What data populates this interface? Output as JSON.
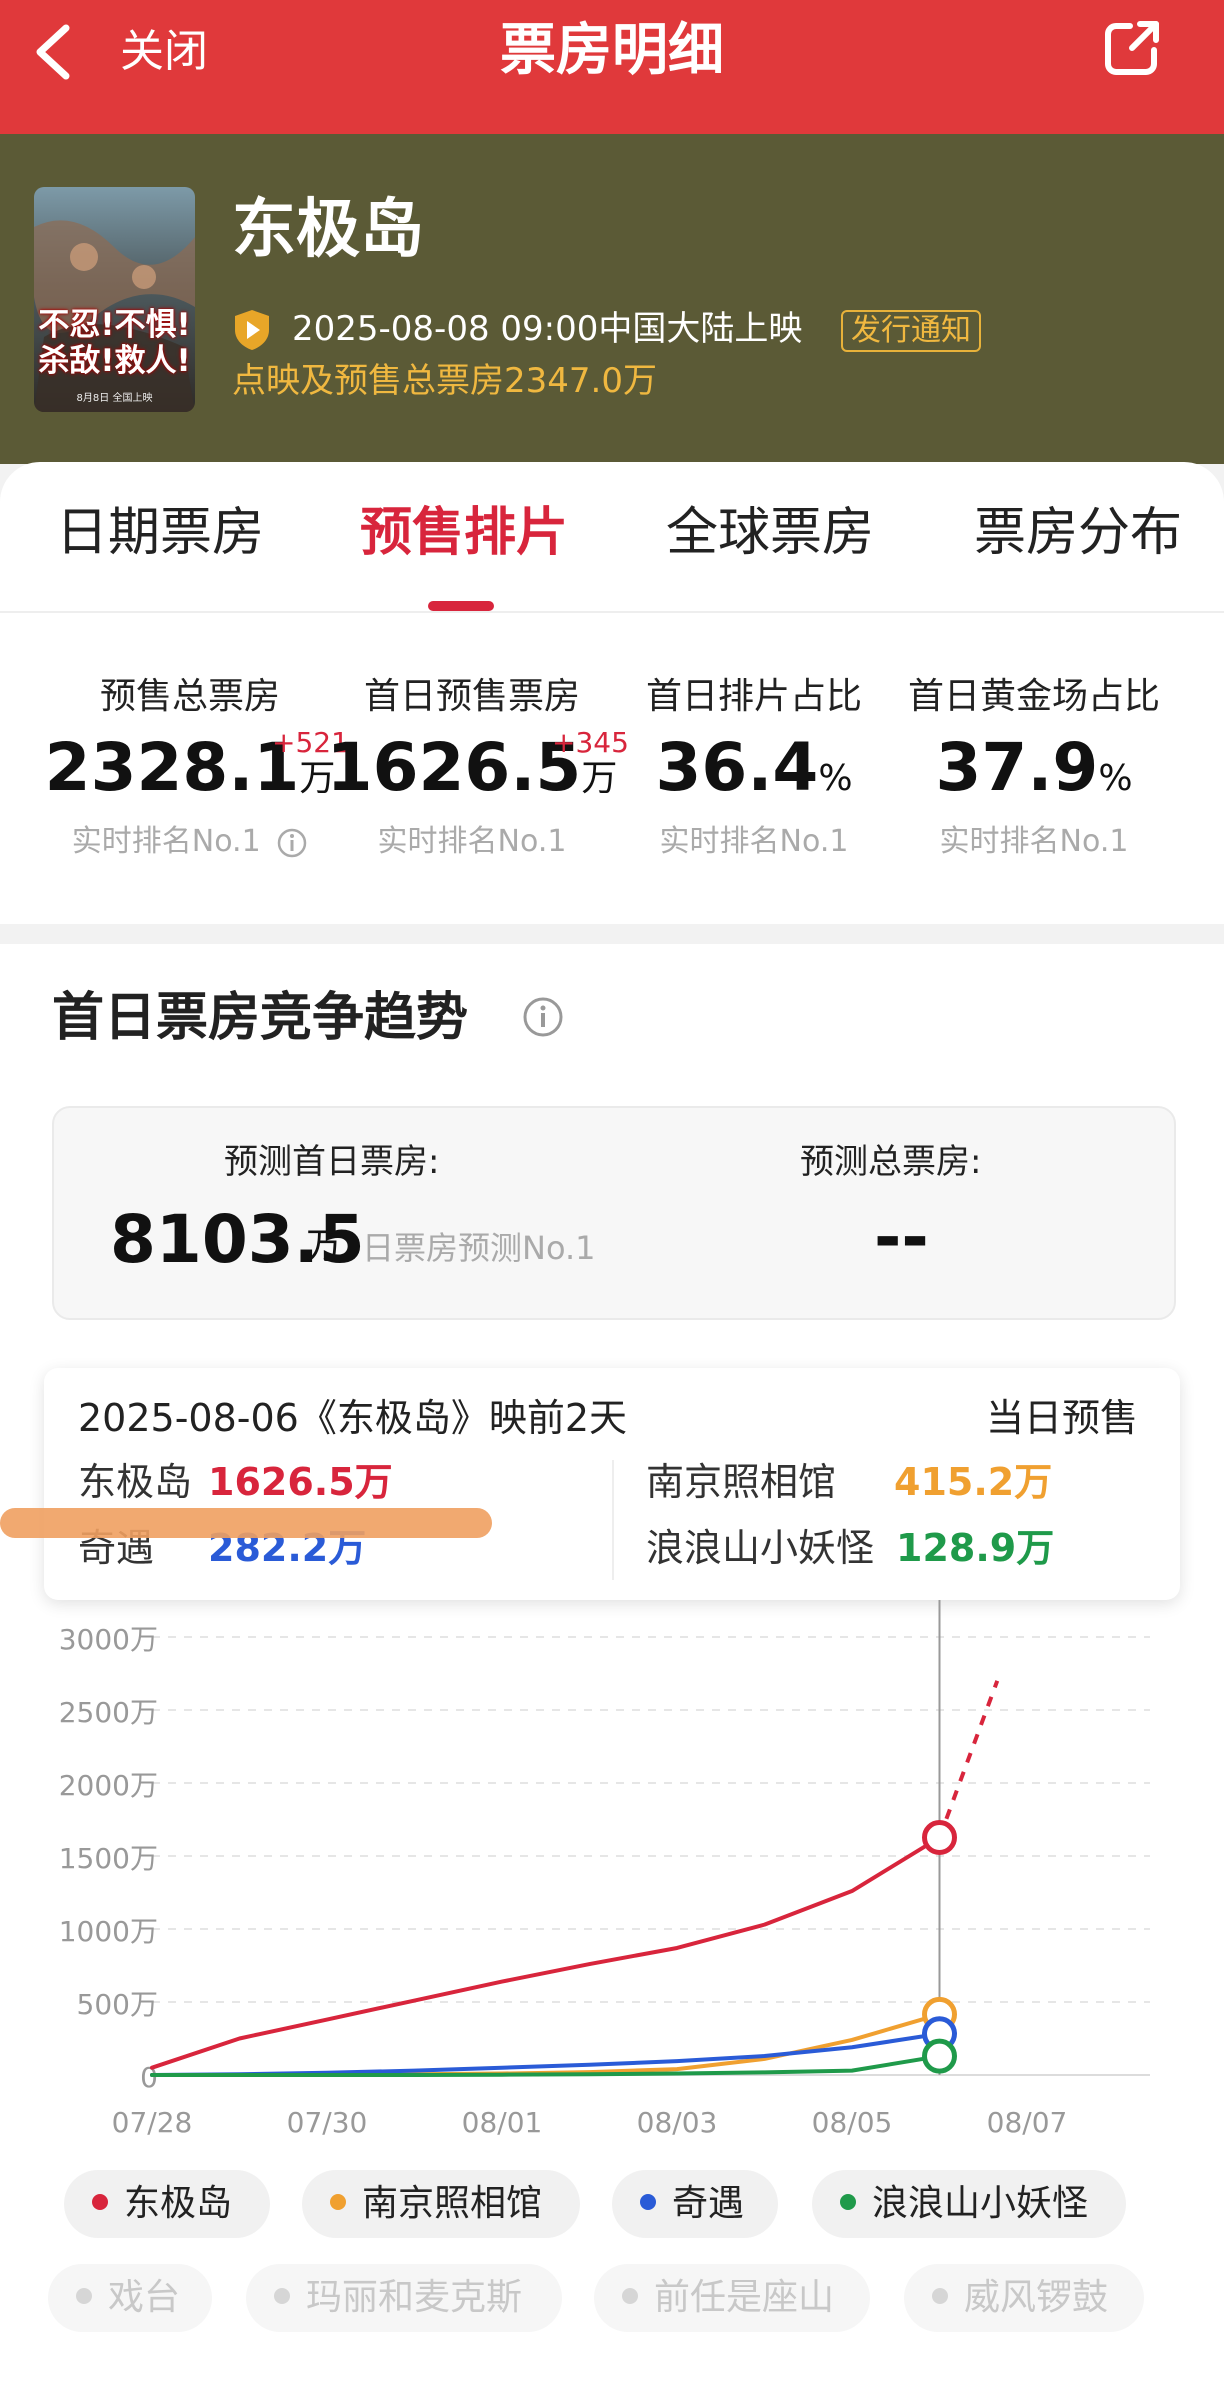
{
  "topbar": {
    "close_label": "关闭",
    "title": "票房明细"
  },
  "movie": {
    "title": "东极岛",
    "release": "2025-08-08 09:00中国大陆上映",
    "notice": "发行通知",
    "presale_total": "点映及预售总票房2347.0万",
    "poster_text": "不忍!不惧!杀敌!救人!",
    "poster_date": "8月8日 全国上映"
  },
  "tabs": [
    "日期票房",
    "预售排片",
    "全球票房",
    "票房分布"
  ],
  "active_tab": 1,
  "stats": [
    {
      "label": "预售总票房",
      "value": "2328.1",
      "unit": "万",
      "delta": "+521",
      "rank": "实时排名No.1"
    },
    {
      "label": "首日预售票房",
      "value": "1626.5",
      "unit": "万",
      "delta": "+345",
      "rank": "实时排名No.1"
    },
    {
      "label": "首日排片占比",
      "value": "36.4",
      "unit": "%",
      "delta": "",
      "rank": "实时排名No.1"
    },
    {
      "label": "首日黄金场占比",
      "value": "37.9",
      "unit": "%",
      "delta": "",
      "rank": "实时排名No.1"
    }
  ],
  "trend": {
    "title": "首日票房竞争趋势",
    "forecast_first_label": "预测首日票房:",
    "forecast_first_value": "8103.5",
    "forecast_first_unit": "万",
    "forecast_first_rank": "日票房预测No.1",
    "forecast_total_label": "预测总票房:",
    "forecast_total_value": "--"
  },
  "tooltip": {
    "date": "2025-08-06《东极岛》映前2天",
    "type": "当日预售",
    "items": [
      {
        "name": "东极岛",
        "value": "1626.5万"
      },
      {
        "name": "南京照相馆",
        "value": "415.2万"
      },
      {
        "name": "奇遇",
        "value": "282.2万"
      },
      {
        "name": "浪浪山小妖怪",
        "value": "128.9万"
      }
    ]
  },
  "colors": {
    "accent": "#d8253c",
    "topbar": "#e0393b",
    "header": "#5b5a36",
    "gold": "#f0b840"
  },
  "chart_data": {
    "type": "line",
    "x": [
      "07/28",
      "07/29",
      "07/30",
      "07/31",
      "08/01",
      "08/02",
      "08/03",
      "08/04",
      "08/05",
      "08/06"
    ],
    "x_ticks": [
      "07/28",
      "07/30",
      "08/01",
      "08/03",
      "08/05",
      "08/07"
    ],
    "y_ticks": [
      "0",
      "500万",
      "1000万",
      "1500万",
      "2000万",
      "2500万",
      "3000万"
    ],
    "ylim": [
      0,
      3000
    ],
    "grid": true,
    "series": [
      {
        "name": "东极岛",
        "color": "#d8253c",
        "values": [
          50,
          250,
          380,
          510,
          640,
          760,
          870,
          1030,
          1260,
          1626.5
        ],
        "projection": [
          2700
        ]
      },
      {
        "name": "南京照相馆",
        "color": "#f0a030",
        "values": [
          0,
          0,
          0,
          5,
          10,
          20,
          40,
          110,
          240,
          415.2
        ]
      },
      {
        "name": "奇遇",
        "color": "#2a5bd7",
        "values": [
          0,
          5,
          15,
          30,
          50,
          70,
          95,
          130,
          190,
          282.2
        ]
      },
      {
        "name": "浪浪山小妖怪",
        "color": "#1f9a4a",
        "values": [
          0,
          0,
          0,
          0,
          2,
          5,
          10,
          18,
          30,
          128.9
        ]
      }
    ],
    "inactive_series": [
      "戏台",
      "玛丽和麦克斯",
      "前任是座山",
      "威风锣鼓"
    ]
  }
}
